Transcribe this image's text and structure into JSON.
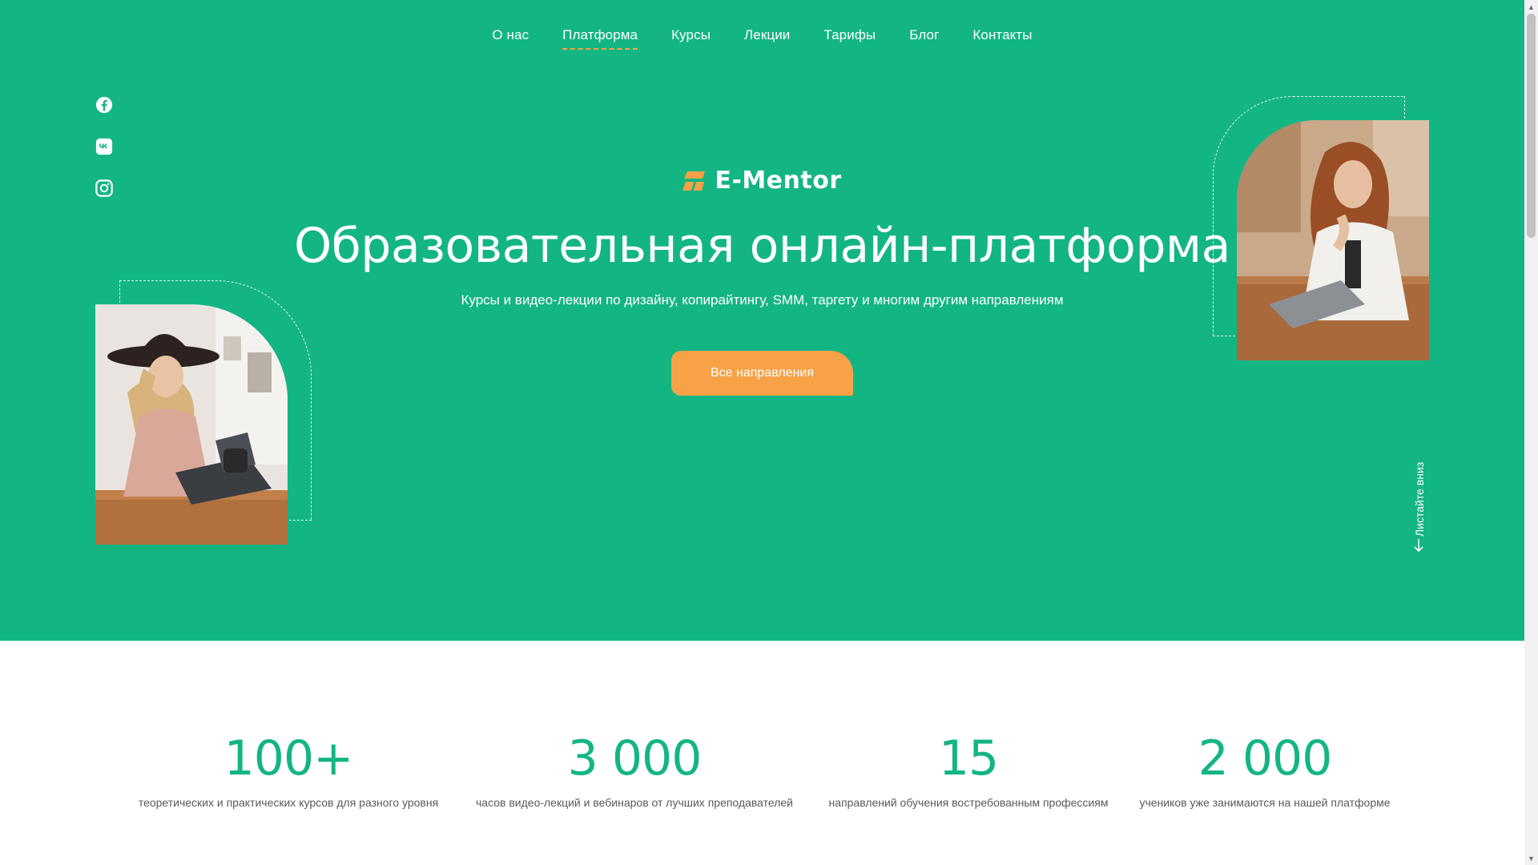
{
  "nav": {
    "items": [
      {
        "label": "О нас"
      },
      {
        "label": "Платформа"
      },
      {
        "label": "Курсы"
      },
      {
        "label": "Лекции"
      },
      {
        "label": "Тарифы"
      },
      {
        "label": "Блог"
      },
      {
        "label": "Контакты"
      }
    ],
    "active": "Платформа"
  },
  "socials": [
    {
      "icon": "facebook-icon"
    },
    {
      "icon": "vk-icon"
    },
    {
      "icon": "instagram-icon"
    }
  ],
  "brand": {
    "name": "E-Mentor",
    "accent": "#f7a246",
    "primary": "#13b583"
  },
  "hero": {
    "title": "Образовательная онлайн-платформа",
    "subtitle": "Курсы и видео-лекции по дизайну, копирайтингу, SMM, таргету и многим другим направлениям",
    "cta_label": "Все направления",
    "scroll_hint": "Листайте вниз"
  },
  "stats": [
    {
      "value": "100+",
      "label": "теоретических и практических курсов для разного уровня"
    },
    {
      "value": "3 000",
      "label": "часов видео-лекций и вебинаров от лучших преподавателей"
    },
    {
      "value": "15",
      "label": "направлений обучения востребованным профессиям"
    },
    {
      "value": "2 000",
      "label": "учеников уже занимаются на нашей платформе"
    }
  ]
}
